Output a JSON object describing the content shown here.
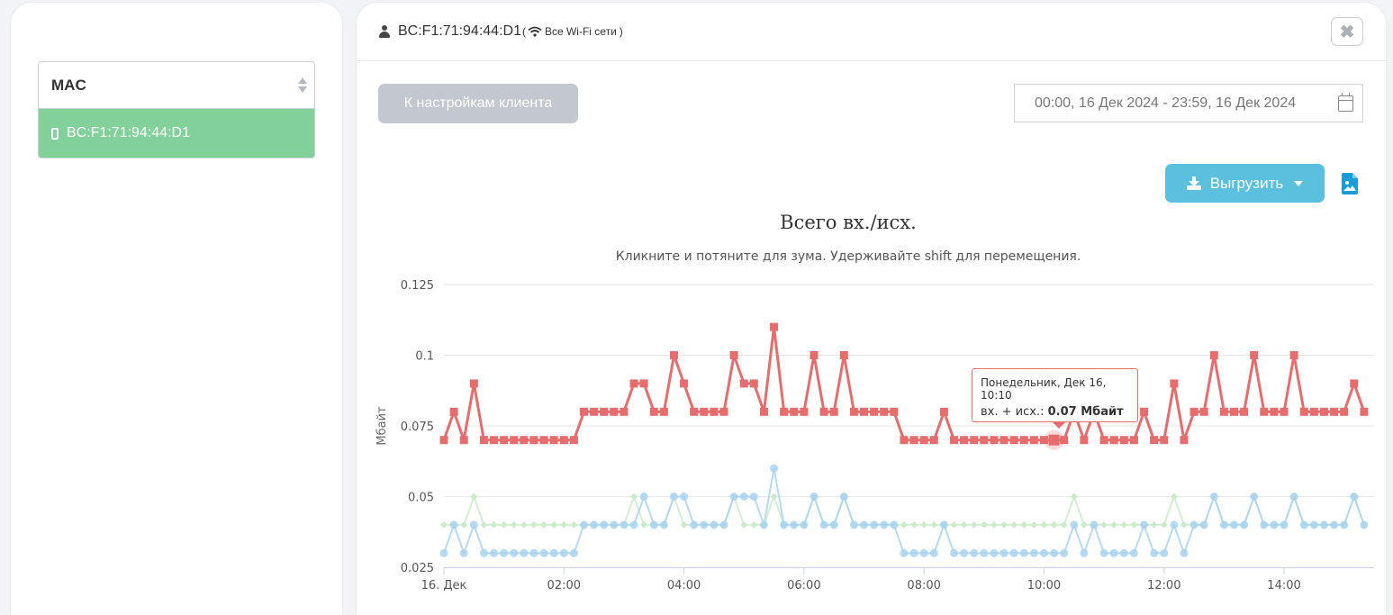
{
  "sidebar": {
    "column_header": "MAC",
    "rows": [
      {
        "mac": "BC:F1:71:94:44:D1"
      }
    ]
  },
  "header": {
    "client_mac": "BC:F1:71:94:44:D1",
    "network_open": "(",
    "network_label": "Все Wi-Fi сети",
    "network_close": ")",
    "close_glyph": "✖"
  },
  "toolbar": {
    "back_label": "К настройкам клиента",
    "date_range": "00:00, 16 Дек 2024 - 23:59, 16 Дек 2024",
    "export_label": "Выгрузить"
  },
  "tooltip": {
    "date": "Понедельник, Дек 16, 10:10",
    "series_label": "вх. + исх.: ",
    "value": "0.07 Мбайт"
  },
  "colors": {
    "total": "#e66d6d",
    "in": "#a9d3ee",
    "out": "#cdebcb",
    "selected_row": "#82d19a",
    "export_button": "#5bc0de"
  },
  "chart_data": {
    "type": "line",
    "title": "Всего вх./исх.",
    "subtitle": "Кликните и потяните для зума. Удерживайте shift для перемещения.",
    "ylabel": "Мбайт",
    "ylim": [
      0.025,
      0.125
    ],
    "yticks": [
      0.025,
      0.05,
      0.075,
      0.1,
      0.125
    ],
    "ytick_labels": [
      "0.025",
      "0.05",
      "0.075",
      "0.1",
      "0.125"
    ],
    "x_start_minutes": 0,
    "x_step_minutes": 10,
    "xticks_minutes": [
      0,
      120,
      240,
      360,
      480,
      600,
      720,
      840
    ],
    "xtick_labels": [
      "16. Дек",
      "02:00",
      "04:00",
      "06:00",
      "08:00",
      "10:00",
      "12:00",
      "14:00"
    ],
    "xlim_minutes": [
      0,
      930
    ],
    "series": [
      {
        "key": "total",
        "values": [
          0.07,
          0.08,
          0.07,
          0.09,
          0.07,
          0.07,
          0.07,
          0.07,
          0.07,
          0.07,
          0.07,
          0.07,
          0.07,
          0.07,
          0.08,
          0.08,
          0.08,
          0.08,
          0.08,
          0.09,
          0.09,
          0.08,
          0.08,
          0.1,
          0.09,
          0.08,
          0.08,
          0.08,
          0.08,
          0.1,
          0.09,
          0.09,
          0.08,
          0.11,
          0.08,
          0.08,
          0.08,
          0.1,
          0.08,
          0.08,
          0.1,
          0.08,
          0.08,
          0.08,
          0.08,
          0.08,
          0.07,
          0.07,
          0.07,
          0.07,
          0.08,
          0.07,
          0.07,
          0.07,
          0.07,
          0.07,
          0.07,
          0.07,
          0.07,
          0.07,
          0.07,
          0.07,
          0.07,
          0.08,
          0.07,
          0.08,
          0.07,
          0.07,
          0.07,
          0.07,
          0.08,
          0.07,
          0.07,
          0.09,
          0.07,
          0.08,
          0.08,
          0.1,
          0.08,
          0.08,
          0.08,
          0.1,
          0.08,
          0.08,
          0.08,
          0.1,
          0.08,
          0.08,
          0.08,
          0.08,
          0.08,
          0.09,
          0.08
        ]
      },
      {
        "key": "in",
        "values": [
          0.03,
          0.04,
          0.03,
          0.04,
          0.03,
          0.03,
          0.03,
          0.03,
          0.03,
          0.03,
          0.03,
          0.03,
          0.03,
          0.03,
          0.04,
          0.04,
          0.04,
          0.04,
          0.04,
          0.04,
          0.05,
          0.04,
          0.04,
          0.05,
          0.05,
          0.04,
          0.04,
          0.04,
          0.04,
          0.05,
          0.05,
          0.05,
          0.04,
          0.06,
          0.04,
          0.04,
          0.04,
          0.05,
          0.04,
          0.04,
          0.05,
          0.04,
          0.04,
          0.04,
          0.04,
          0.04,
          0.03,
          0.03,
          0.03,
          0.03,
          0.04,
          0.03,
          0.03,
          0.03,
          0.03,
          0.03,
          0.03,
          0.03,
          0.03,
          0.03,
          0.03,
          0.03,
          0.03,
          0.04,
          0.03,
          0.04,
          0.03,
          0.03,
          0.03,
          0.03,
          0.04,
          0.03,
          0.03,
          0.04,
          0.03,
          0.04,
          0.04,
          0.05,
          0.04,
          0.04,
          0.04,
          0.05,
          0.04,
          0.04,
          0.04,
          0.05,
          0.04,
          0.04,
          0.04,
          0.04,
          0.04,
          0.05,
          0.04
        ]
      },
      {
        "key": "out",
        "values": [
          0.04,
          0.04,
          0.04,
          0.05,
          0.04,
          0.04,
          0.04,
          0.04,
          0.04,
          0.04,
          0.04,
          0.04,
          0.04,
          0.04,
          0.04,
          0.04,
          0.04,
          0.04,
          0.04,
          0.05,
          0.04,
          0.04,
          0.04,
          0.05,
          0.04,
          0.04,
          0.04,
          0.04,
          0.04,
          0.05,
          0.04,
          0.04,
          0.04,
          0.05,
          0.04,
          0.04,
          0.04,
          0.05,
          0.04,
          0.04,
          0.05,
          0.04,
          0.04,
          0.04,
          0.04,
          0.04,
          0.04,
          0.04,
          0.04,
          0.04,
          0.04,
          0.04,
          0.04,
          0.04,
          0.04,
          0.04,
          0.04,
          0.04,
          0.04,
          0.04,
          0.04,
          0.04,
          0.04,
          0.05,
          0.04,
          0.04,
          0.04,
          0.04,
          0.04,
          0.04,
          0.04,
          0.04,
          0.04,
          0.05,
          0.04,
          0.04,
          0.04,
          0.05,
          0.04,
          0.04,
          0.04,
          0.05,
          0.04,
          0.04,
          0.04,
          0.05,
          0.04,
          0.04,
          0.04,
          0.04,
          0.04,
          0.05,
          0.04
        ]
      }
    ],
    "highlight": {
      "series": "total",
      "index": 61
    }
  }
}
